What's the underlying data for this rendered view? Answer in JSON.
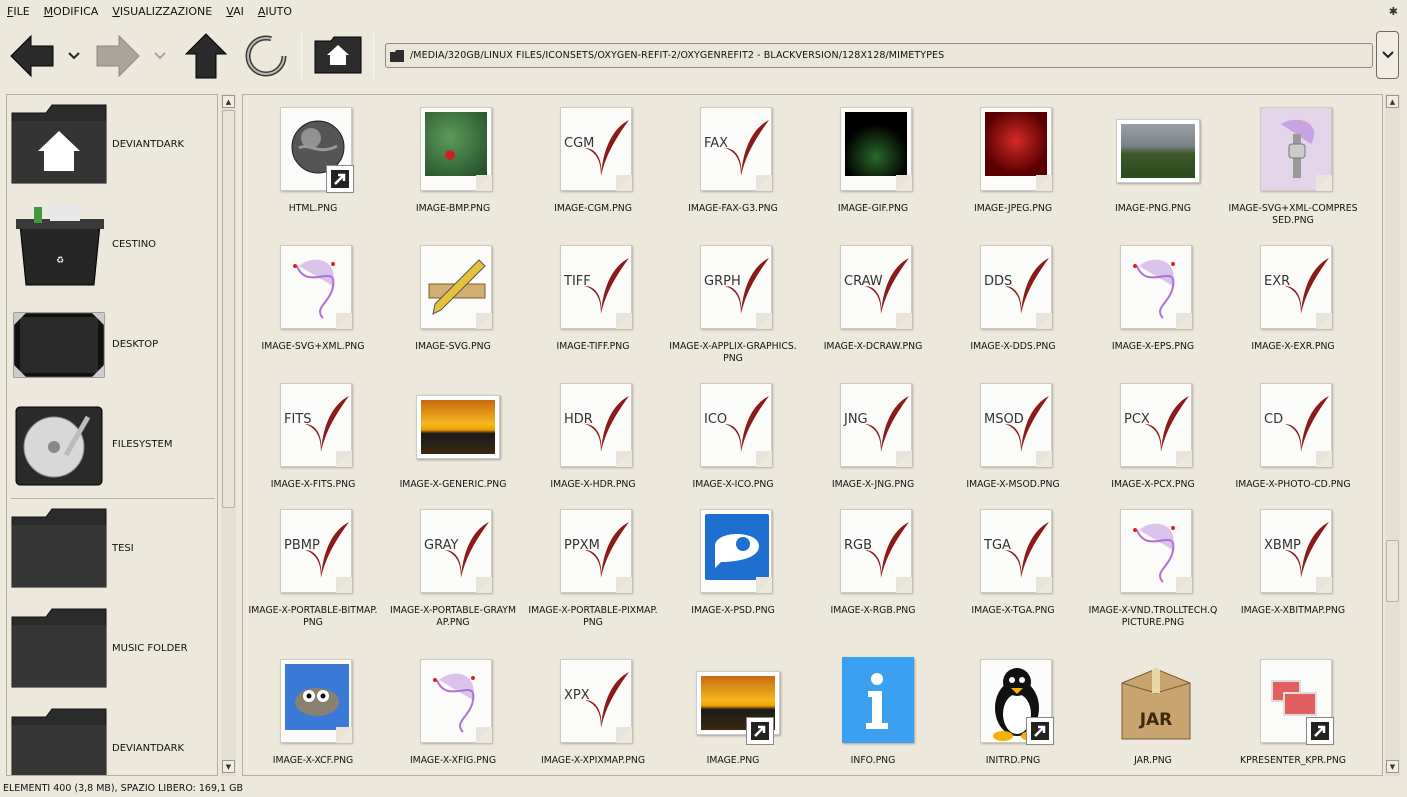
{
  "menubar": {
    "items": [
      "FILE",
      "MODIFICA",
      "VISUALIZZAZIONE",
      "VAI",
      "AIUTO"
    ]
  },
  "toolbar": {
    "back_icon": "back-arrow-icon",
    "forward_icon": "forward-arrow-icon",
    "up_icon": "up-arrow-icon",
    "reload_icon": "reload-icon",
    "home_icon": "home-icon"
  },
  "location": {
    "path": "/MEDIA/320GB/LINUX FILES/ICONSETS/OXYGEN-REFIT-2/OXYGENREFIT2 - BLACKVERSION/128X128/MIMETYPES"
  },
  "sidebar": {
    "items": [
      {
        "label": "DEVIANTDARK",
        "icon": "home-folder-icon"
      },
      {
        "label": "CESTINO",
        "icon": "trash-icon"
      },
      {
        "label": "DESKTOP",
        "icon": "desktop-icon"
      },
      {
        "label": "FILESYSTEM",
        "icon": "hard-disk-icon"
      },
      {
        "label": "TESI",
        "icon": "folder-icon"
      },
      {
        "label": "MUSIC FOLDER",
        "icon": "folder-icon"
      },
      {
        "label": "DEVIANTDARK",
        "icon": "folder-icon"
      }
    ]
  },
  "files": [
    {
      "name": "HTML.PNG",
      "icon": "globe-icon",
      "link": true
    },
    {
      "name": "IMAGE-BMP.PNG",
      "icon": "photo-leaves-icon",
      "link": false
    },
    {
      "name": "IMAGE-CGM.PNG",
      "icon": "document-icon",
      "label": "CGM",
      "link": false
    },
    {
      "name": "IMAGE-FAX-G3.PNG",
      "icon": "document-icon",
      "label": "FAX",
      "link": false
    },
    {
      "name": "IMAGE-GIF.PNG",
      "icon": "photo-dark-icon",
      "link": false
    },
    {
      "name": "IMAGE-JPEG.PNG",
      "icon": "photo-rose-icon",
      "link": false
    },
    {
      "name": "IMAGE-PNG.PNG",
      "icon": "photo-landscape-icon",
      "link": false
    },
    {
      "name": "IMAGE-SVG+XML-COMPRESSED.PNG",
      "icon": "svg-zip-icon",
      "link": false
    },
    {
      "name": "IMAGE-SVG+XML.PNG",
      "icon": "svg-curve-icon",
      "link": false
    },
    {
      "name": "IMAGE-SVG.PNG",
      "icon": "ruler-pencil-icon",
      "link": false
    },
    {
      "name": "IMAGE-TIFF.PNG",
      "icon": "document-icon",
      "label": "TIFF",
      "link": false
    },
    {
      "name": "IMAGE-X-APPLIX-GRAPHICS.PNG",
      "icon": "document-icon",
      "label": "GRPH",
      "link": false
    },
    {
      "name": "IMAGE-X-DCRAW.PNG",
      "icon": "document-icon",
      "label": "CRAW",
      "link": false
    },
    {
      "name": "IMAGE-X-DDS.PNG",
      "icon": "document-icon",
      "label": "DDS",
      "link": false
    },
    {
      "name": "IMAGE-X-EPS.PNG",
      "icon": "svg-curve-icon",
      "link": false
    },
    {
      "name": "IMAGE-X-EXR.PNG",
      "icon": "document-icon",
      "label": "EXR",
      "link": false
    },
    {
      "name": "IMAGE-X-FITS.PNG",
      "icon": "document-icon",
      "label": "FITS",
      "link": false
    },
    {
      "name": "IMAGE-X-GENERIC.PNG",
      "icon": "photo-sunset-icon",
      "link": false
    },
    {
      "name": "IMAGE-X-HDR.PNG",
      "icon": "document-icon",
      "label": "HDR",
      "link": false
    },
    {
      "name": "IMAGE-X-ICO.PNG",
      "icon": "document-icon",
      "label": "ICO",
      "link": false
    },
    {
      "name": "IMAGE-X-JNG.PNG",
      "icon": "document-icon",
      "label": "JNG",
      "link": false
    },
    {
      "name": "IMAGE-X-MSOD.PNG",
      "icon": "document-icon",
      "label": "MSOD",
      "link": false
    },
    {
      "name": "IMAGE-X-PCX.PNG",
      "icon": "document-icon",
      "label": "PCX",
      "link": false
    },
    {
      "name": "IMAGE-X-PHOTO-CD.PNG",
      "icon": "document-icon",
      "label": "CD",
      "link": false
    },
    {
      "name": "IMAGE-X-PORTABLE-BITMAP.PNG",
      "icon": "document-icon",
      "label": "PBMP",
      "link": false
    },
    {
      "name": "IMAGE-X-PORTABLE-GRAYMAP.PNG",
      "icon": "document-icon",
      "label": "GRAY",
      "link": false
    },
    {
      "name": "IMAGE-X-PORTABLE-PIXMAP.PNG",
      "icon": "document-icon",
      "label": "PPXM",
      "link": false
    },
    {
      "name": "IMAGE-X-PSD.PNG",
      "icon": "photoshop-icon",
      "link": false
    },
    {
      "name": "IMAGE-X-RGB.PNG",
      "icon": "document-icon",
      "label": "RGB",
      "link": false
    },
    {
      "name": "IMAGE-X-TGA.PNG",
      "icon": "document-icon",
      "label": "TGA",
      "link": false
    },
    {
      "name": "IMAGE-X-VND.TROLLTECH.QPICTURE.PNG",
      "icon": "svg-curve-icon",
      "link": false
    },
    {
      "name": "IMAGE-X-XBITMAP.PNG",
      "icon": "document-icon",
      "label": "XBMP",
      "link": false
    },
    {
      "name": "IMAGE-X-XCF.PNG",
      "icon": "gimp-icon",
      "link": false
    },
    {
      "name": "IMAGE-X-XFIG.PNG",
      "icon": "svg-curve-icon",
      "link": false
    },
    {
      "name": "IMAGE-X-XPIXMAP.PNG",
      "icon": "document-icon",
      "label": "XPX",
      "link": false
    },
    {
      "name": "IMAGE.PNG",
      "icon": "photo-sunset-icon",
      "link": true
    },
    {
      "name": "INFO.PNG",
      "icon": "info-icon",
      "link": false
    },
    {
      "name": "INITRD.PNG",
      "icon": "tux-icon",
      "link": true
    },
    {
      "name": "JAR.PNG",
      "icon": "jar-box-icon",
      "link": false
    },
    {
      "name": "KPRESENTER_KPR.PNG",
      "icon": "presentation-icon",
      "link": true
    }
  ],
  "status": {
    "text": "ELEMENTI 400 (3,8 MB), SPAZIO LIBERO: 169,1 GB"
  },
  "colors": {
    "background": "#ede8dc",
    "document_accent": "#8b1a1a",
    "svg_accent": "#b070d8"
  }
}
